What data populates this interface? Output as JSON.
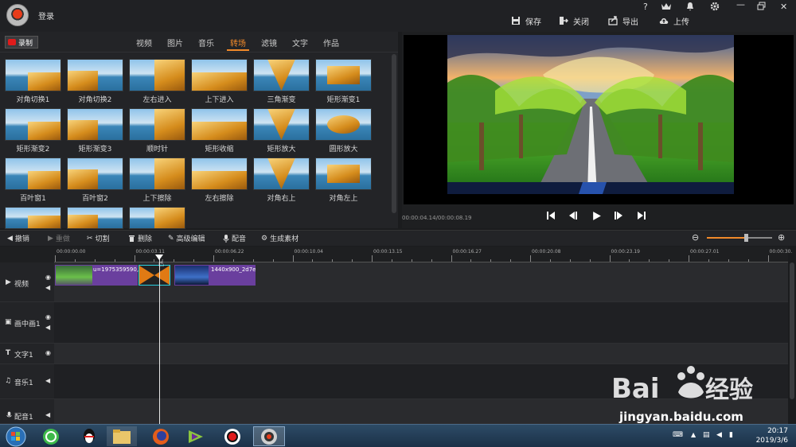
{
  "titlebar": {
    "login_label": "登录",
    "help_label": "?",
    "vip_label": "VIP",
    "actions": {
      "save": "保存",
      "close": "关闭",
      "export": "导出",
      "upload": "上传"
    }
  },
  "left_panel": {
    "record_label": "录制",
    "tabs": [
      "视频",
      "图片",
      "音乐",
      "转场",
      "滤镜",
      "文字",
      "作品"
    ],
    "active_tab": "转场",
    "transitions": [
      "对角切换1",
      "对角切换2",
      "左右进入",
      "上下进入",
      "三角渐变",
      "矩形渐变1",
      "矩形渐变2",
      "矩形渐变3",
      "顺时针",
      "矩形收缩",
      "矩形放大",
      "圆形放大",
      "百叶窗1",
      "百叶窗2",
      "上下擦除",
      "左右擦除",
      "对角右上",
      "对角左上"
    ]
  },
  "preview": {
    "timecode": "00:00:04.14/00:00:08.19"
  },
  "toolbar": {
    "undo": "撤销",
    "redo": "重做",
    "cut": "切割",
    "delete": "删除",
    "advanced_edit": "高级编辑",
    "dub": "配音",
    "generate": "生成素材"
  },
  "timeline": {
    "ticks": [
      "00:00:00.00",
      "00:00:03.11",
      "00:00:06.22",
      "00:00:10.04",
      "00:00:13.15",
      "00:00:16.27",
      "00:00:20.08",
      "00:00:23.19",
      "00:00:27.01",
      "00:00:30."
    ],
    "tracks": [
      "视频",
      "画中画1",
      "文字1",
      "音乐1",
      "配音1"
    ],
    "clip1_label": "u=1975359590,",
    "clip3_label": "1440x900_2d7e"
  },
  "taskbar": {
    "time": "20:17",
    "date": "2019/3/6"
  },
  "watermark": {
    "text": "jingyan.baidu.com"
  },
  "colors": {
    "accent": "#f28a2a",
    "clip": "#6a3f9e",
    "record": "#e01b1b"
  }
}
